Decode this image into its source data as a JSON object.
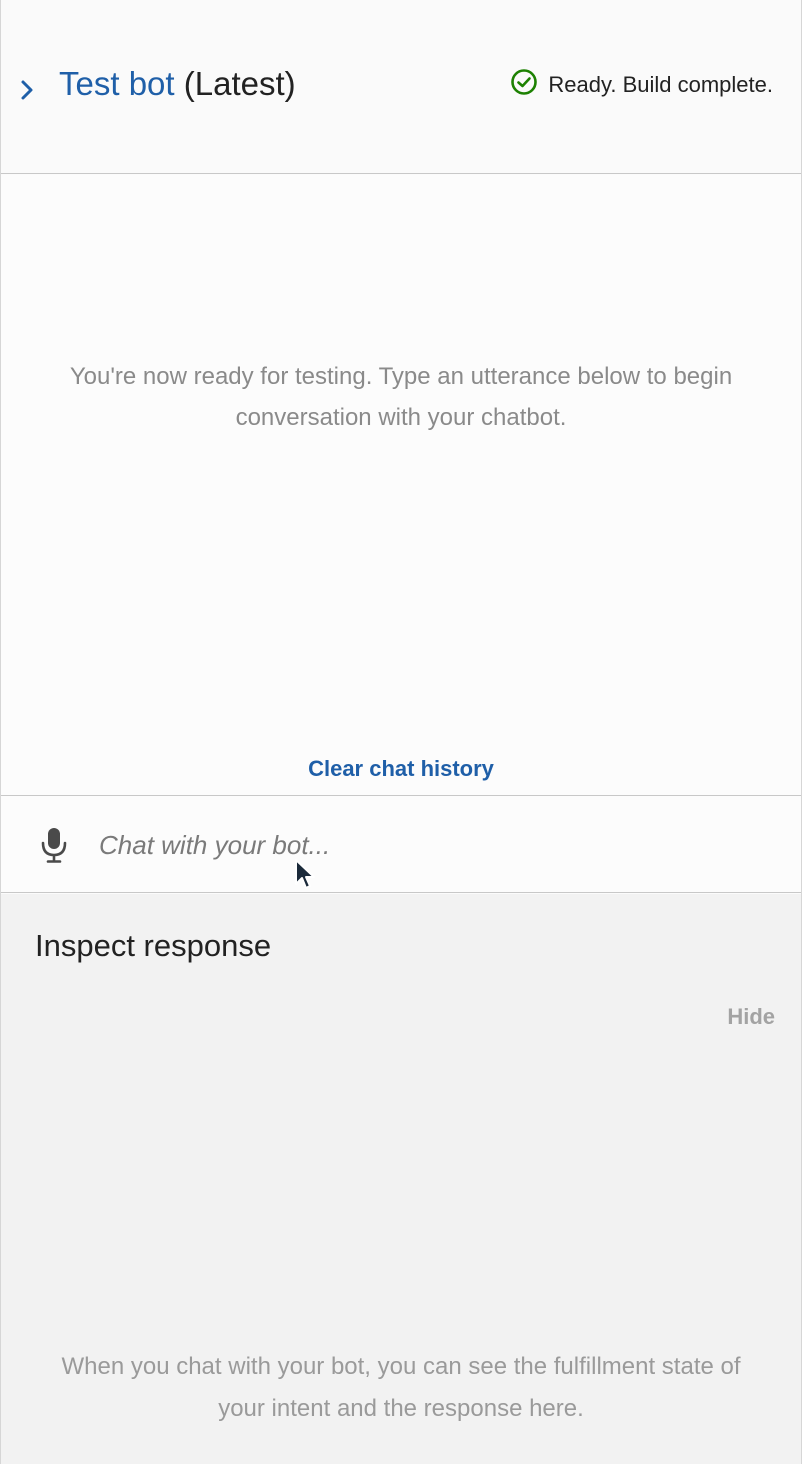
{
  "header": {
    "title_link": "Test bot",
    "title_suffix": "(Latest)",
    "status_text": "Ready. Build complete.",
    "status_color": "#1d8102",
    "expand_icon": "chevron-right-icon",
    "status_icon": "check-circle-icon"
  },
  "chat": {
    "intro_text": "You're now ready for testing. Type an utterance below to begin conversation with your chatbot.",
    "clear_label": "Clear chat history",
    "input_placeholder": "Chat with your bot...",
    "mic_icon": "microphone-icon"
  },
  "inspect": {
    "title": "Inspect response",
    "hide_label": "Hide",
    "note": "When you chat with your bot, you can see the fulfillment state of your intent and the response here."
  },
  "colors": {
    "link": "#1f5fa8",
    "muted_text": "#8a8a8a"
  }
}
